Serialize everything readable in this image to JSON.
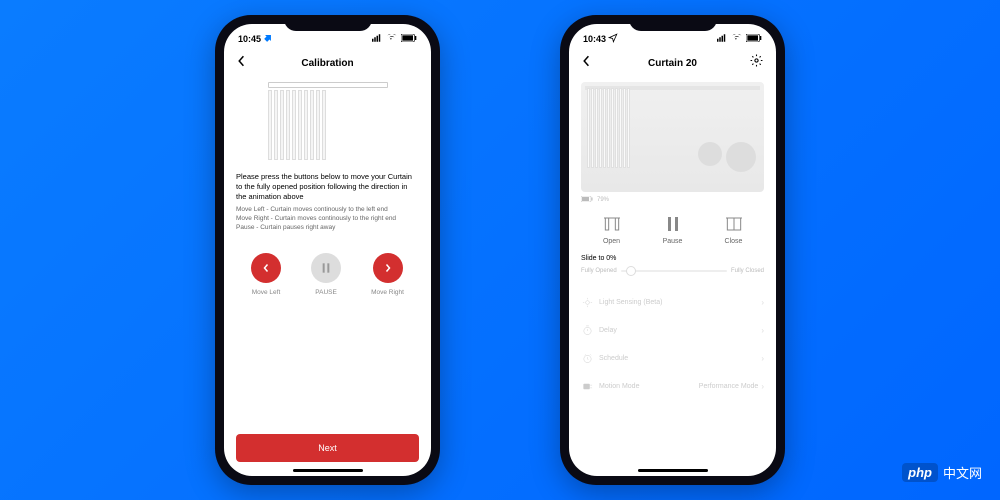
{
  "phone1": {
    "status": {
      "time": "10:45",
      "location_icon": "location-filled"
    },
    "nav": {
      "title": "Calibration"
    },
    "instruction_main": "Please press the buttons below to move your Curtain to the fully opened position following the direction in the animation above",
    "instruction_detail": "Move Left - Curtain moves continously to the left end\nMove Right - Curtain moves continously to the right end\nPause - Curtain pauses right away",
    "controls": {
      "left": "Move Left",
      "pause": "PAUSE",
      "right": "Move Right"
    },
    "next_button": "Next"
  },
  "phone2": {
    "status": {
      "time": "10:43",
      "location_icon": "location-outline"
    },
    "nav": {
      "title": "Curtain 20"
    },
    "battery": {
      "percent": "79%"
    },
    "controls": {
      "open": "Open",
      "pause": "Pause",
      "close": "Close"
    },
    "slide": {
      "label": "Slide to 0%",
      "left_label": "Fully Opened",
      "right_label": "Fully Closed"
    },
    "menu": [
      {
        "icon": "light-sensing-icon",
        "label": "Light Sensing (Beta)",
        "value": ""
      },
      {
        "icon": "delay-icon",
        "label": "Delay",
        "value": ""
      },
      {
        "icon": "schedule-icon",
        "label": "Schedule",
        "value": ""
      },
      {
        "icon": "motion-mode-icon",
        "label": "Motion Mode",
        "value": "Performance Mode"
      }
    ]
  },
  "watermark": {
    "badge": "php",
    "text": "中文网"
  }
}
